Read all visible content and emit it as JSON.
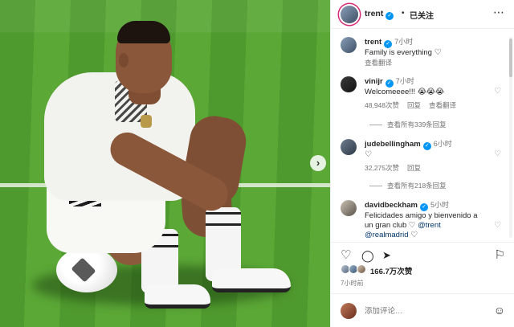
{
  "post_header": {
    "username": "trent",
    "separator": "•",
    "follow_status": "已关注",
    "more": "⋯"
  },
  "comments": [
    {
      "username": "trent",
      "text": "Family is everything",
      "time": "7小时",
      "translate": "查看翻译",
      "heart": "♡"
    },
    {
      "username": "vinijr",
      "time": "7小时",
      "text": "Welcomeeee!!! 😭😭😭",
      "likes": "48,948次赞",
      "reply": "回复",
      "translate": "查看翻译",
      "view_replies": "查看所有339条回复",
      "heart": "♡"
    },
    {
      "username": "judebellingham",
      "time": "6小时",
      "text": "♡",
      "likes": "32,275次赞",
      "reply": "回复",
      "view_replies": "查看所有218条回复",
      "heart": "♡"
    },
    {
      "username": "davidbeckham",
      "time": "5小时",
      "text_line1": "Felicidades amigo y bienvenido a",
      "text_line2": "un gran club ♡ ",
      "mention1": "@trent",
      "mention2": "@realmadrid",
      "heart": "♡"
    }
  ],
  "actions": {
    "like": "♡",
    "comment": "◯",
    "share": "➤",
    "save": "⚐"
  },
  "likes": "166.7万次赞",
  "post_time": "7小时前",
  "add_comment": {
    "placeholder": "添加评论…",
    "emoji": "☺"
  },
  "photo_nav": {
    "next": "›"
  },
  "colors": {
    "verified": "#0095f6",
    "mention": "#00376b",
    "pitch_green": "#5ba836",
    "story_ring": "#d62976"
  }
}
